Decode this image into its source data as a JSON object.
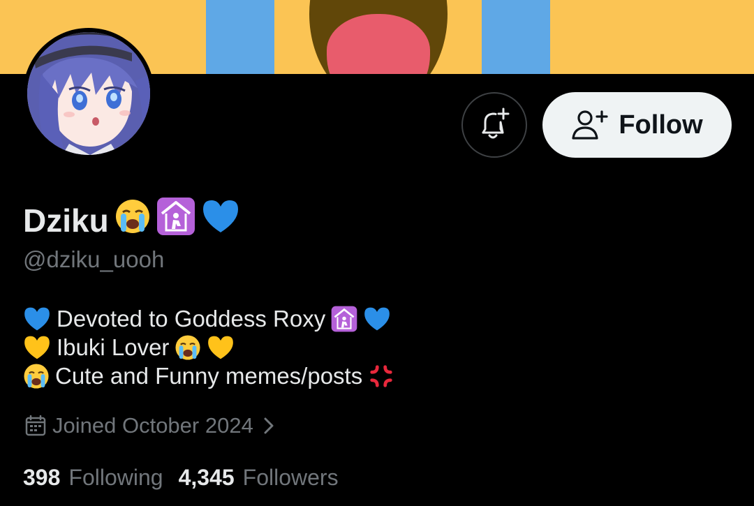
{
  "banner": {
    "colors": {
      "background": "#fbc454",
      "stripe": "#5fa8e6",
      "mouth_outer": "#614709",
      "mouth_inner": "#e85c6c"
    }
  },
  "avatar": {
    "icon": "anime-avatar"
  },
  "actions": {
    "notify_icon": "bell-plus-icon",
    "follow_icon": "person-add-icon",
    "follow_label": "Follow"
  },
  "profile": {
    "display_name": "Dziku",
    "display_name_emojis": [
      "crying-face",
      "place-of-worship",
      "blue-heart"
    ],
    "handle": "@dziku_uooh"
  },
  "bio": {
    "lines": [
      {
        "text": "Devoted to Goddess Roxy",
        "prefix_emoji": "blue-heart",
        "suffix_emojis": [
          "place-of-worship",
          "blue-heart"
        ]
      },
      {
        "text": "Ibuki Lover",
        "prefix_emoji": "yellow-heart",
        "suffix_emojis": [
          "crying-face",
          "yellow-heart"
        ]
      },
      {
        "text": "Cute and Funny memes/posts",
        "prefix_emoji": "crying-face",
        "suffix_emojis": [
          "anger-symbol"
        ]
      }
    ]
  },
  "joined": {
    "icon": "calendar-icon",
    "text": "Joined October 2024",
    "chevron": "chevron-right-icon"
  },
  "stats": {
    "following_count": "398",
    "following_label": "Following",
    "followers_count": "4,345",
    "followers_label": "Followers"
  },
  "colors": {
    "background": "#000000",
    "text_primary": "#e7e9ea",
    "text_secondary": "#71767b",
    "button_bg": "#eff3f4",
    "button_text": "#0f1419",
    "border": "#3e4144"
  }
}
